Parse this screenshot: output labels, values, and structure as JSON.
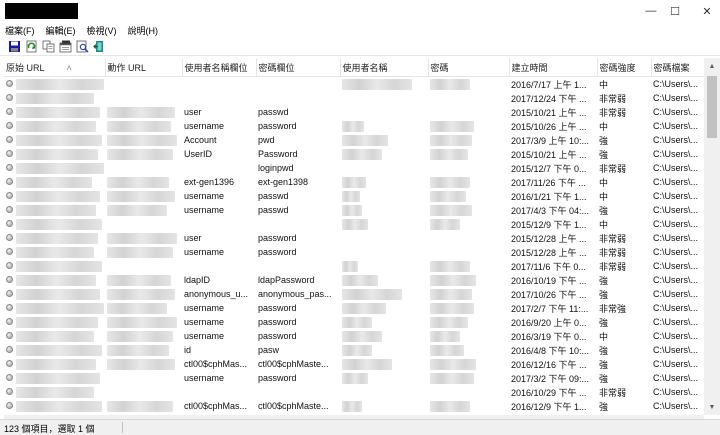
{
  "window": {
    "minimize_glyph": "—",
    "maximize_glyph": "☐",
    "close_glyph": "✕"
  },
  "menu": [
    "檔案(F)",
    "編輯(E)",
    "檢視(V)",
    "說明(H)"
  ],
  "toolbar": [
    {
      "name": "save-icon",
      "color": "#1a1aa0"
    },
    {
      "name": "refresh-icon",
      "color": "#208a20"
    },
    {
      "name": "copy-icon",
      "color": "#555555"
    },
    {
      "name": "properties-icon",
      "color": "#555555"
    },
    {
      "name": "find-icon",
      "color": "#3050a0"
    },
    {
      "name": "exit-icon",
      "color": "#1a8a8a"
    }
  ],
  "columns": [
    "原始 URL",
    "動作 URL",
    "使用者名稱欄位",
    "密碼欄位",
    "使用者名稱",
    "密碼",
    "建立時間",
    "密碼強度",
    "密碼檔案"
  ],
  "sort_indicator": "˄",
  "rows": [
    {
      "user_field": "",
      "pass_field": "",
      "has_user": true,
      "has_pass": true,
      "created": "2016/7/17 上午 1...",
      "strength": "中",
      "file": "C:\\Users\\..."
    },
    {
      "user_field": "",
      "pass_field": "",
      "has_user": false,
      "has_pass": false,
      "created": "2017/12/24 下午 ...",
      "strength": "非常弱",
      "file": "C:\\Users\\..."
    },
    {
      "user_field": "user",
      "pass_field": "passwd",
      "has_user": false,
      "has_pass": false,
      "created": "2015/10/21 上午 ...",
      "strength": "非常弱",
      "file": "C:\\Users\\..."
    },
    {
      "user_field": "username",
      "pass_field": "password",
      "has_user": true,
      "has_pass": true,
      "created": "2015/10/26 上午 ...",
      "strength": "中",
      "file": "C:\\Users\\..."
    },
    {
      "user_field": "Account",
      "pass_field": "pwd",
      "has_user": true,
      "has_pass": true,
      "created": "2017/3/9 上午 10:...",
      "strength": "強",
      "file": "C:\\Users\\..."
    },
    {
      "user_field": "UserID",
      "pass_field": "Password",
      "has_user": true,
      "has_pass": true,
      "created": "2015/10/21 上午 ...",
      "strength": "強",
      "file": "C:\\Users\\..."
    },
    {
      "user_field": "",
      "pass_field": "loginpwd",
      "has_user": false,
      "has_pass": false,
      "created": "2015/12/7 下午 0...",
      "strength": "非常弱",
      "file": "C:\\Users\\..."
    },
    {
      "user_field": "ext-gen1396",
      "pass_field": "ext-gen1398",
      "has_user": true,
      "has_pass": true,
      "created": "2017/11/26 下午 ...",
      "strength": "中",
      "file": "C:\\Users\\..."
    },
    {
      "user_field": "username",
      "pass_field": "passwd",
      "has_user": true,
      "has_pass": true,
      "created": "2016/1/21 下午 1...",
      "strength": "中",
      "file": "C:\\Users\\..."
    },
    {
      "user_field": "username",
      "pass_field": "passwd",
      "has_user": true,
      "has_pass": true,
      "created": "2017/4/3 下午 04:...",
      "strength": "強",
      "file": "C:\\Users\\..."
    },
    {
      "user_field": "",
      "pass_field": "",
      "has_user": true,
      "has_pass": true,
      "created": "2015/12/9 下午 1...",
      "strength": "中",
      "file": "C:\\Users\\..."
    },
    {
      "user_field": "user",
      "pass_field": "password",
      "has_user": false,
      "has_pass": false,
      "created": "2015/12/28 上午 ...",
      "strength": "非常弱",
      "file": "C:\\Users\\..."
    },
    {
      "user_field": "username",
      "pass_field": "password",
      "has_user": false,
      "has_pass": false,
      "created": "2015/12/28 上午 ...",
      "strength": "非常弱",
      "file": "C:\\Users\\..."
    },
    {
      "user_field": "",
      "pass_field": "",
      "has_user": true,
      "has_pass": true,
      "created": "2017/11/6 下午 0...",
      "strength": "非常弱",
      "file": "C:\\Users\\..."
    },
    {
      "user_field": "ldapID",
      "pass_field": "ldapPassword",
      "has_user": true,
      "has_pass": true,
      "created": "2016/10/19 下午 ...",
      "strength": "強",
      "file": "C:\\Users\\..."
    },
    {
      "user_field": "anonymous_u...",
      "pass_field": "anonymous_pas...",
      "has_user": true,
      "has_pass": true,
      "created": "2017/10/26 下午 ...",
      "strength": "強",
      "file": "C:\\Users\\..."
    },
    {
      "user_field": "username",
      "pass_field": "password",
      "has_user": true,
      "has_pass": true,
      "created": "2017/2/7 下午 11:...",
      "strength": "非常強",
      "file": "C:\\Users\\..."
    },
    {
      "user_field": "username",
      "pass_field": "password",
      "has_user": true,
      "has_pass": true,
      "created": "2016/9/20 上午 0...",
      "strength": "強",
      "file": "C:\\Users\\..."
    },
    {
      "user_field": "username",
      "pass_field": "password",
      "has_user": true,
      "has_pass": true,
      "created": "2016/3/19 下午 0...",
      "strength": "中",
      "file": "C:\\Users\\..."
    },
    {
      "user_field": "id",
      "pass_field": "pasw",
      "has_user": true,
      "has_pass": true,
      "created": "2016/4/8 下午 10:...",
      "strength": "強",
      "file": "C:\\Users\\..."
    },
    {
      "user_field": "ctl00$cphMas...",
      "pass_field": "ctl00$cphMaste...",
      "has_user": true,
      "has_pass": true,
      "created": "2016/12/16 下午 ...",
      "strength": "強",
      "file": "C:\\Users\\..."
    },
    {
      "user_field": "username",
      "pass_field": "password",
      "has_user": true,
      "has_pass": true,
      "created": "2017/3/2 下午 09:...",
      "strength": "強",
      "file": "C:\\Users\\..."
    },
    {
      "user_field": "",
      "pass_field": "",
      "has_user": false,
      "has_pass": false,
      "created": "2016/10/29 下午 ...",
      "strength": "非常弱",
      "file": "C:\\Users\\..."
    },
    {
      "user_field": "ctl00$cphMas...",
      "pass_field": "ctl00$cphMaste...",
      "has_user": true,
      "has_pass": true,
      "created": "2016/12/9 下午 1...",
      "strength": "強",
      "file": "C:\\Users\\..."
    }
  ],
  "status": "123 個項目，選取 1 個"
}
